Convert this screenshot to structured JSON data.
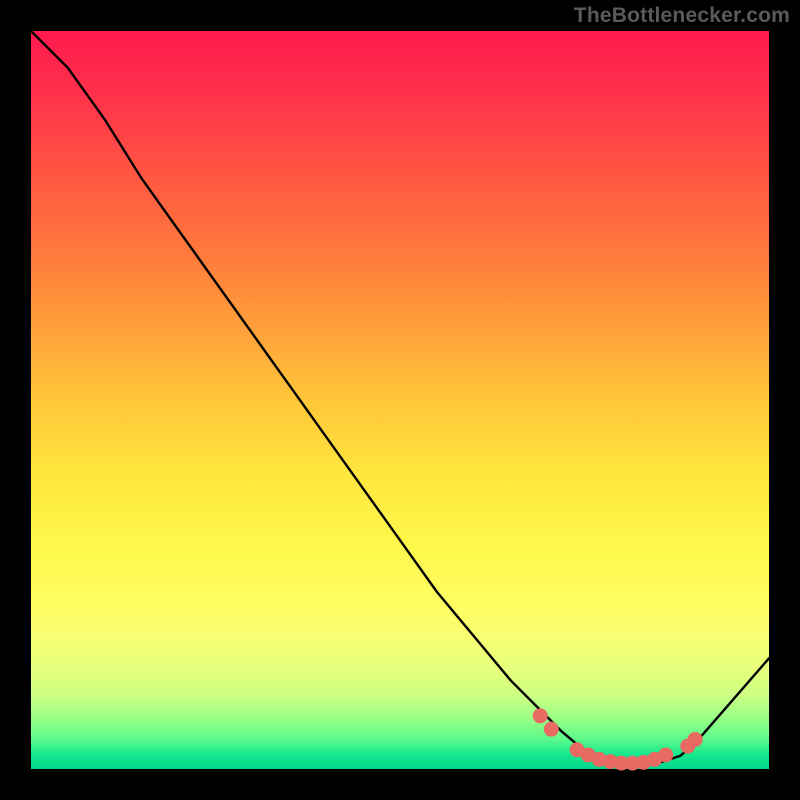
{
  "attribution": "TheBottlenecker.com",
  "colors": {
    "background": "#000000",
    "gradient_top": "#ff1a4d",
    "gradient_bottom": "#00d58c",
    "curve": "#000000",
    "dots": "#e96a63"
  },
  "chart_data": {
    "type": "line",
    "title": "",
    "xlabel": "",
    "ylabel": "",
    "xlim": [
      0,
      100
    ],
    "ylim": [
      0,
      100
    ],
    "series": [
      {
        "name": "curve",
        "x": [
          0,
          5,
          10,
          15,
          20,
          25,
          30,
          35,
          40,
          45,
          50,
          55,
          60,
          65,
          70,
          72,
          75,
          78,
          80,
          82,
          85,
          88,
          90,
          100
        ],
        "y": [
          100,
          95,
          88,
          80,
          73,
          66,
          59,
          52,
          45,
          38,
          31,
          24,
          18,
          12,
          7,
          5,
          2.5,
          1.2,
          0.8,
          0.6,
          0.8,
          1.8,
          3.5,
          15
        ]
      }
    ],
    "highlight_points": {
      "name": "bottom-cluster",
      "points": [
        {
          "x": 69,
          "y": 7.2
        },
        {
          "x": 70.5,
          "y": 5.4
        },
        {
          "x": 74,
          "y": 2.6
        },
        {
          "x": 75.5,
          "y": 1.9
        },
        {
          "x": 77,
          "y": 1.3
        },
        {
          "x": 78.5,
          "y": 1.0
        },
        {
          "x": 80,
          "y": 0.8
        },
        {
          "x": 81.5,
          "y": 0.8
        },
        {
          "x": 83,
          "y": 0.9
        },
        {
          "x": 84.5,
          "y": 1.3
        },
        {
          "x": 86,
          "y": 1.9
        },
        {
          "x": 89,
          "y": 3.1
        },
        {
          "x": 90,
          "y": 4.0
        }
      ]
    }
  }
}
